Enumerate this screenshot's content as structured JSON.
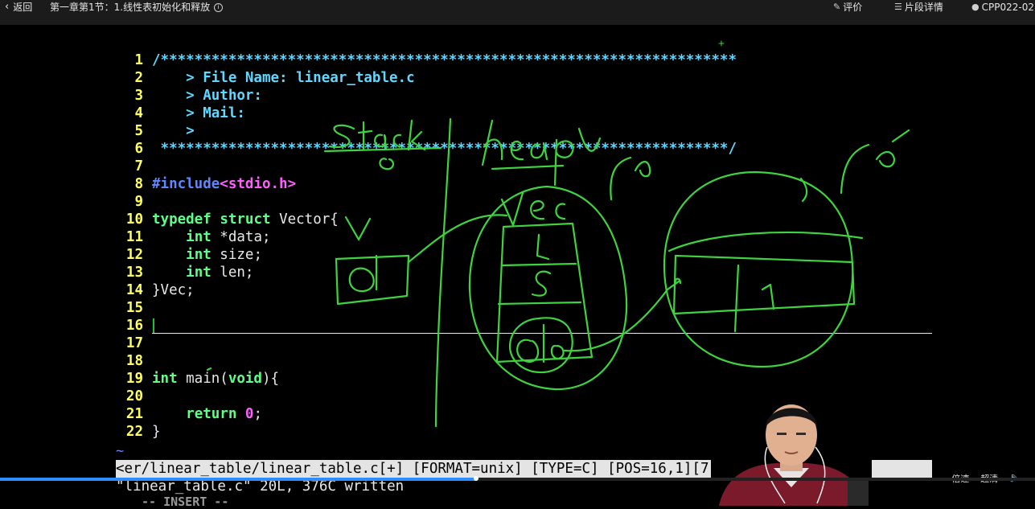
{
  "topbar": {
    "back_label": "返回",
    "lesson_title": "第一章第1节：1.线性表初始化和释放",
    "rate_label": "评价",
    "segments_label": "片段详情",
    "user_label": "CPP022-02"
  },
  "editor": {
    "lines": [
      {
        "n": "1",
        "parts": [
          {
            "t": "/********************************************************************",
            "c": "cmt"
          }
        ]
      },
      {
        "n": "2",
        "parts": [
          {
            "t": "    > File Name: linear_table.c",
            "c": "cmt"
          }
        ]
      },
      {
        "n": "3",
        "parts": [
          {
            "t": "    > Author:",
            "c": "cmt"
          }
        ]
      },
      {
        "n": "4",
        "parts": [
          {
            "t": "    > Mail:",
            "c": "cmt"
          }
        ]
      },
      {
        "n": "5",
        "parts": [
          {
            "t": "    >",
            "c": "cmt"
          }
        ]
      },
      {
        "n": "6",
        "parts": [
          {
            "t": " *******************************************************************/",
            "c": "cmt"
          }
        ]
      },
      {
        "n": "7",
        "parts": []
      },
      {
        "n": "8",
        "parts": [
          {
            "t": "#include",
            "c": "pp"
          },
          {
            "t": "<stdio.h>",
            "c": "inc"
          }
        ]
      },
      {
        "n": "9",
        "parts": []
      },
      {
        "n": "10",
        "parts": [
          {
            "t": "typedef",
            "c": "kw"
          },
          {
            "t": " ",
            "c": "plain"
          },
          {
            "t": "struct",
            "c": "kw"
          },
          {
            "t": " Vector{",
            "c": "plain"
          }
        ]
      },
      {
        "n": "11",
        "parts": [
          {
            "t": "    ",
            "c": "plain"
          },
          {
            "t": "int",
            "c": "kw"
          },
          {
            "t": " *data;",
            "c": "plain"
          }
        ]
      },
      {
        "n": "12",
        "parts": [
          {
            "t": "    ",
            "c": "plain"
          },
          {
            "t": "int",
            "c": "kw"
          },
          {
            "t": " size;",
            "c": "plain"
          }
        ]
      },
      {
        "n": "13",
        "parts": [
          {
            "t": "    ",
            "c": "plain"
          },
          {
            "t": "int",
            "c": "kw"
          },
          {
            "t": " len;",
            "c": "plain"
          }
        ]
      },
      {
        "n": "14",
        "parts": [
          {
            "t": "}Vec;",
            "c": "plain"
          }
        ]
      },
      {
        "n": "15",
        "parts": []
      },
      {
        "n": "16",
        "parts": []
      },
      {
        "n": "17",
        "parts": []
      },
      {
        "n": "18",
        "parts": []
      },
      {
        "n": "19",
        "parts": [
          {
            "t": "int",
            "c": "kw"
          },
          {
            "t": " main(",
            "c": "plain"
          },
          {
            "t": "void",
            "c": "kw"
          },
          {
            "t": "){",
            "c": "plain"
          }
        ]
      },
      {
        "n": "20",
        "parts": []
      },
      {
        "n": "21",
        "parts": [
          {
            "t": "    ",
            "c": "plain"
          },
          {
            "t": "return",
            "c": "kw"
          },
          {
            "t": " ",
            "c": "plain"
          },
          {
            "t": "0",
            "c": "num"
          },
          {
            "t": ";",
            "c": "plain"
          }
        ]
      },
      {
        "n": "22",
        "parts": [
          {
            "t": "}",
            "c": "plain"
          }
        ]
      }
    ],
    "tilde": "~",
    "status_line": "<er/linear_table/linear_table.c[+] [FORMAT=unix] [TYPE=C] [POS=16,1][7",
    "message_line": "\"linear_table.c\" 20L, 376C written",
    "mode_line": "-- INSERT --"
  },
  "player": {
    "speed_label": "倍速",
    "quality_label": "超清",
    "progress": 0.46
  },
  "colors": {
    "ink": "#3fd33f",
    "line_numbers": "#ffff5f",
    "comment": "#5fd7ff",
    "keyword": "#5fff87"
  }
}
